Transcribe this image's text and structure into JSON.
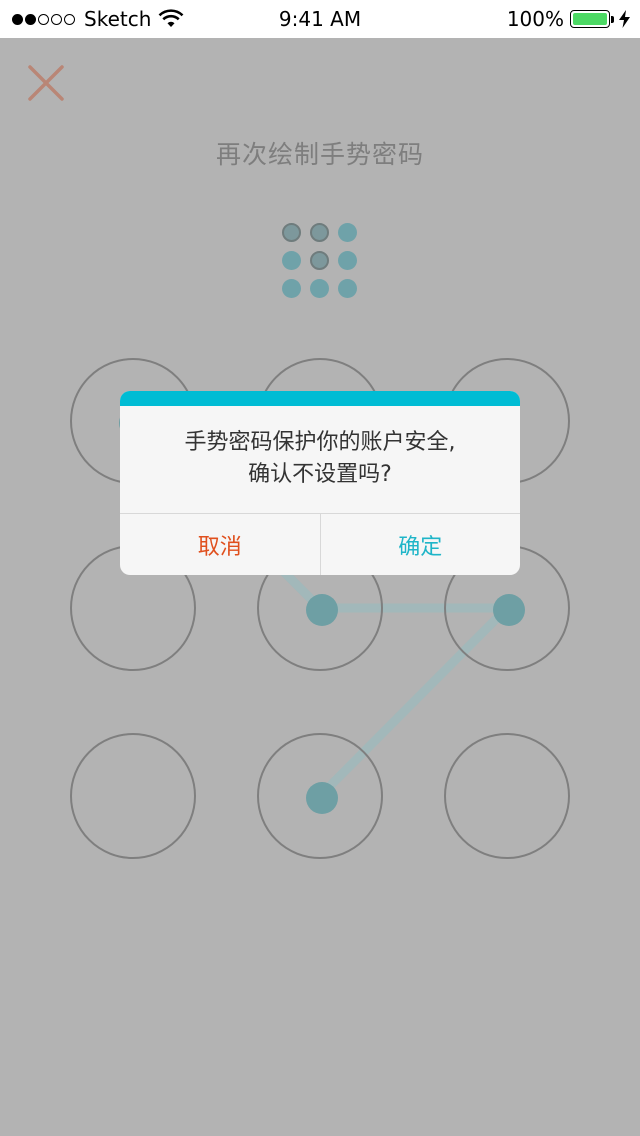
{
  "status_bar": {
    "carrier": "Sketch",
    "time": "9:41 AM",
    "battery": "100%",
    "signal_bars_filled": 2,
    "signal_bars_total": 5
  },
  "page": {
    "title": "再次绘制手势密码"
  },
  "preview_dots_selected": [
    0,
    1,
    4
  ],
  "pattern": {
    "selected_nodes": [
      0,
      4,
      5,
      7
    ],
    "path_order": [
      0,
      4,
      5,
      7
    ]
  },
  "dialog": {
    "line1": "手势密码保护你的账户安全,",
    "line2": "确认不设置吗?",
    "cancel_label": "取消",
    "confirm_label": "确定",
    "accent_color": "#00bcd4",
    "cancel_color": "#e0501e",
    "confirm_color": "#1fb5c8"
  },
  "icons": {
    "close": "close-icon",
    "wifi": "wifi-icon",
    "battery": "battery-icon",
    "charging": "bolt-icon"
  }
}
